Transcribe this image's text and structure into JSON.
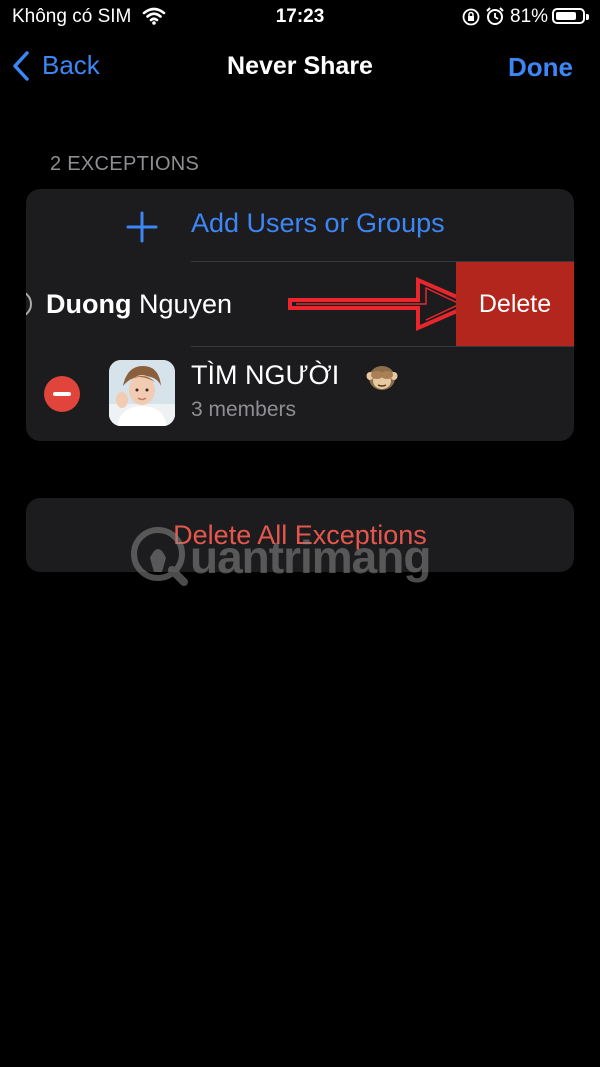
{
  "status_bar": {
    "carrier": "Không có SIM",
    "time": "17:23",
    "battery_percent": "81%",
    "battery_level": 0.81,
    "icons": [
      "wifi-icon",
      "orientation-lock-icon",
      "alarm-icon",
      "battery-icon"
    ]
  },
  "nav": {
    "back_label": "Back",
    "title": "Never Share",
    "done_label": "Done"
  },
  "section": {
    "header": "2 EXCEPTIONS"
  },
  "add_row": {
    "label": "Add Users or Groups",
    "icon": "plus-icon"
  },
  "contact_row": {
    "first_name": "Duong",
    "last_name": "Nguyen",
    "delete_label": "Delete"
  },
  "group_row": {
    "name": "TÌM NGƯỜI",
    "emoji": "🙈",
    "members": "3 members"
  },
  "delete_all_label": "Delete All Exceptions",
  "watermark": {
    "text": "uantrimang"
  },
  "colors": {
    "accent": "#3d86f5",
    "destructive": "#e5574d",
    "delete_action_bg": "#b3261e",
    "card_bg": "#1c1c1e",
    "annotation_arrow": "#e8262b"
  }
}
